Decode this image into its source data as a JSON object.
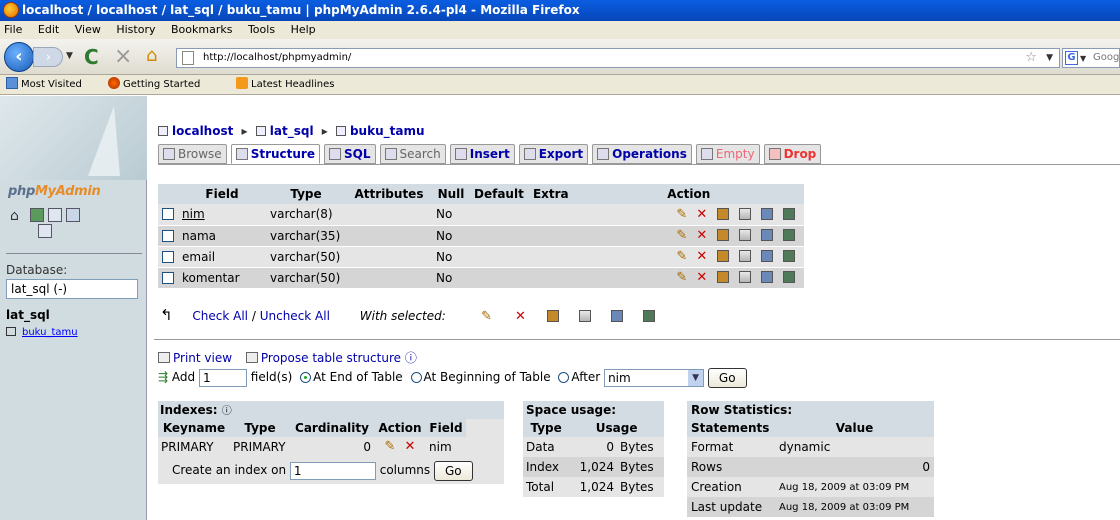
{
  "window": {
    "title": "localhost / localhost / lat_sql / buku_tamu | phpMyAdmin 2.6.4-pl4 - Mozilla Firefox"
  },
  "menu": [
    "File",
    "Edit",
    "View",
    "History",
    "Bookmarks",
    "Tools",
    "Help"
  ],
  "nav": {
    "url": "http://localhost/phpmyadmin/",
    "search_placeholder": "Google"
  },
  "bookmarks": [
    "Most Visited",
    "Getting Started",
    "Latest Headlines"
  ],
  "sidebar": {
    "logo_a": "php",
    "logo_b": "MyAdmin",
    "database_label": "Database:",
    "database_value": "lat_sql (-)",
    "db_name": "lat_sql",
    "table_link": "buku_tamu"
  },
  "breadcrumb": {
    "server": "localhost",
    "db": "lat_sql",
    "table": "buku_tamu"
  },
  "tabs": [
    "Browse",
    "Structure",
    "SQL",
    "Search",
    "Insert",
    "Export",
    "Operations",
    "Empty",
    "Drop"
  ],
  "fields_table": {
    "headers": [
      "Field",
      "Type",
      "Attributes",
      "Null",
      "Default",
      "Extra",
      "Action"
    ],
    "rows": [
      {
        "field": "nim",
        "type": "varchar(8)",
        "attributes": "",
        "null": "No",
        "default": "",
        "extra": ""
      },
      {
        "field": "nama",
        "type": "varchar(35)",
        "attributes": "",
        "null": "No",
        "default": "",
        "extra": ""
      },
      {
        "field": "email",
        "type": "varchar(50)",
        "attributes": "",
        "null": "No",
        "default": "",
        "extra": ""
      },
      {
        "field": "komentar",
        "type": "varchar(50)",
        "attributes": "",
        "null": "No",
        "default": "",
        "extra": ""
      }
    ]
  },
  "checkall": {
    "check_all": "Check All",
    "separator": "/",
    "uncheck_all": "Uncheck All",
    "with_selected": "With selected:"
  },
  "links": {
    "print_view": "Print view",
    "propose": "Propose table structure"
  },
  "add": {
    "label": "Add",
    "value": "1",
    "fields_text": "field(s)",
    "opt_end": "At End of Table",
    "opt_begin": "At Beginning of Table",
    "opt_after": "After",
    "after_value": "nim",
    "go": "Go"
  },
  "indexes": {
    "title": "Indexes:",
    "headers": [
      "Keyname",
      "Type",
      "Cardinality",
      "Action",
      "Field"
    ],
    "row": {
      "keyname": "PRIMARY",
      "type": "PRIMARY",
      "cardinality": "0",
      "field": "nim"
    },
    "create_prefix": "Create an index on",
    "create_value": "1",
    "create_suffix": "columns",
    "go": "Go"
  },
  "space": {
    "title": "Space usage:",
    "headers": [
      "Type",
      "Usage"
    ],
    "rows": [
      {
        "type": "Data",
        "value": "0",
        "unit": "Bytes"
      },
      {
        "type": "Index",
        "value": "1,024",
        "unit": "Bytes"
      },
      {
        "type": "Total",
        "value": "1,024",
        "unit": "Bytes"
      }
    ]
  },
  "rowstats": {
    "title": "Row Statistics:",
    "headers": [
      "Statements",
      "Value"
    ],
    "rows": [
      {
        "k": "Format",
        "v": "dynamic"
      },
      {
        "k": "Rows",
        "v": "0"
      },
      {
        "k": "Creation",
        "v": "Aug 18, 2009 at 03:09 PM"
      },
      {
        "k": "Last update",
        "v": "Aug 18, 2009 at 03:09 PM"
      }
    ]
  }
}
